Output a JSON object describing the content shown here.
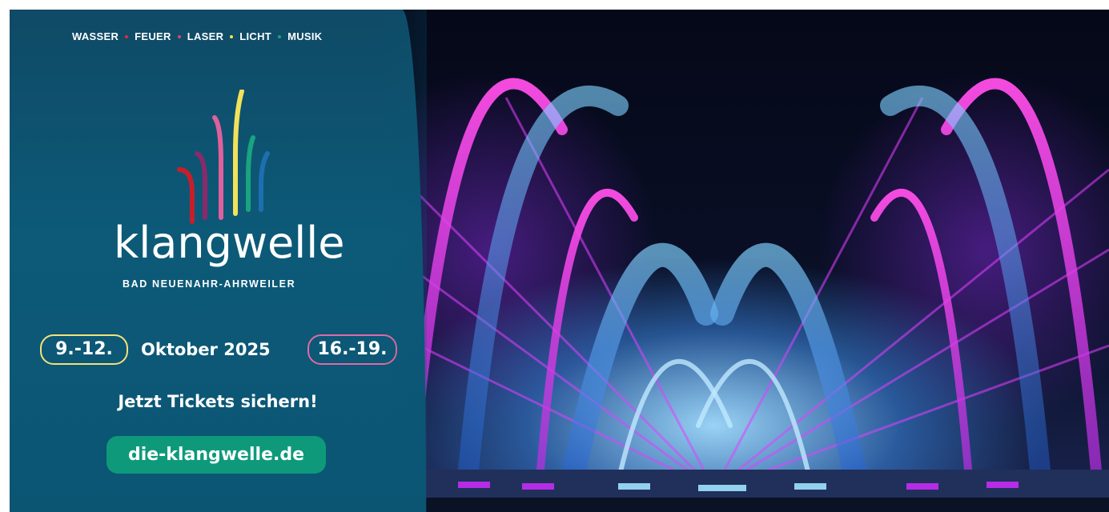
{
  "tagline": {
    "items": [
      {
        "label": "WASSER",
        "dot_color": "#e02a3a"
      },
      {
        "label": "FEUER",
        "dot_color": "#e0436e"
      },
      {
        "label": "LASER",
        "dot_color": "#f2e15a"
      },
      {
        "label": "LICHT",
        "dot_color": "#1aa37f"
      },
      {
        "label": "MUSIK",
        "dot_color": ""
      }
    ]
  },
  "logo": {
    "name": "klangwelle",
    "subtitle": "BAD NEUENAHR-AHRWEILER",
    "bar_colors": [
      "#c81e2c",
      "#8a2a6a",
      "#e0609c",
      "#f2e15a",
      "#1aa37f",
      "#1e6fb0"
    ]
  },
  "dates": {
    "first": "9.-12.",
    "month": "Oktober 2025",
    "second": "16.-19."
  },
  "cta": "Jetzt Tickets sichern!",
  "url": "die-klangwelle.de",
  "colors": {
    "panel": "#0c5a78",
    "first_pill_border": "#f4e27a",
    "second_pill_border": "#e26aa4",
    "url_button": "#0e9a7a"
  }
}
